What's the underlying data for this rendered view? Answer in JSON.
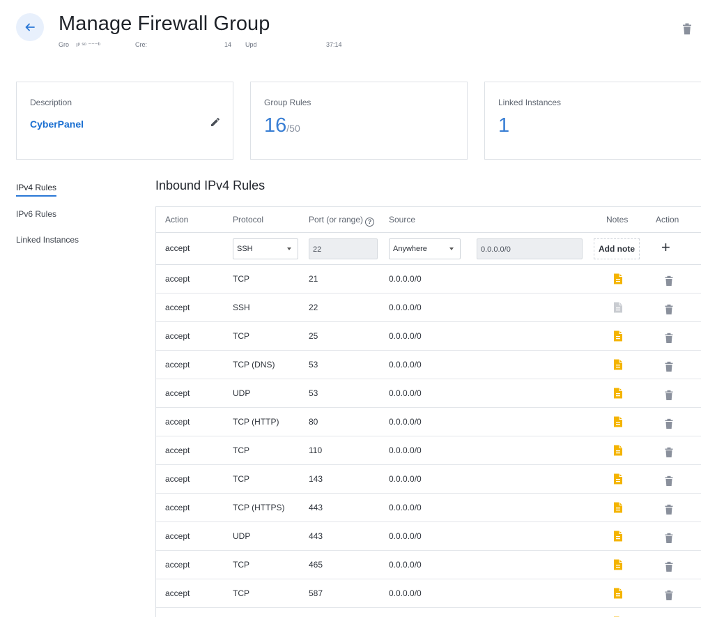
{
  "header": {
    "title": "Manage Firewall Group",
    "meta": {
      "group_label": "Gro",
      "group_value": "ıᵖ  ˢᵒ    ⁻⁻⁻ᵇ",
      "created_label": "Cre:",
      "created_value": "14",
      "updated_label": "Upd",
      "updated_value": "37:14"
    }
  },
  "cards": {
    "description": {
      "label": "Description",
      "value": "CyberPanel"
    },
    "group_rules": {
      "label": "Group Rules",
      "count": "16",
      "max": "/50"
    },
    "linked_instances": {
      "label": "Linked Instances",
      "count": "1"
    }
  },
  "side_nav": {
    "items": [
      {
        "label": "IPv4 Rules",
        "active": true
      },
      {
        "label": "IPv6 Rules",
        "active": false
      },
      {
        "label": "Linked Instances",
        "active": false
      }
    ]
  },
  "section": {
    "title": "Inbound IPv4 Rules"
  },
  "table": {
    "headers": {
      "action": "Action",
      "protocol": "Protocol",
      "port": "Port (or range)",
      "source": "Source",
      "notes": "Notes",
      "action2": "Action"
    },
    "help_glyph": "?",
    "add_row": {
      "action": "accept",
      "protocol": "SSH",
      "port": "22",
      "source": "Anywhere",
      "cidr": "0.0.0.0/0",
      "add_note_label": "Add note",
      "add_symbol": "+"
    },
    "rows": [
      {
        "action": "accept",
        "protocol": "TCP",
        "port": "21",
        "source": "0.0.0.0/0",
        "has_note": true
      },
      {
        "action": "accept",
        "protocol": "SSH",
        "port": "22",
        "source": "0.0.0.0/0",
        "has_note": false
      },
      {
        "action": "accept",
        "protocol": "TCP",
        "port": "25",
        "source": "0.0.0.0/0",
        "has_note": true
      },
      {
        "action": "accept",
        "protocol": "TCP (DNS)",
        "port": "53",
        "source": "0.0.0.0/0",
        "has_note": true
      },
      {
        "action": "accept",
        "protocol": "UDP",
        "port": "53",
        "source": "0.0.0.0/0",
        "has_note": true
      },
      {
        "action": "accept",
        "protocol": "TCP (HTTP)",
        "port": "80",
        "source": "0.0.0.0/0",
        "has_note": true
      },
      {
        "action": "accept",
        "protocol": "TCP",
        "port": "110",
        "source": "0.0.0.0/0",
        "has_note": true
      },
      {
        "action": "accept",
        "protocol": "TCP",
        "port": "143",
        "source": "0.0.0.0/0",
        "has_note": true
      },
      {
        "action": "accept",
        "protocol": "TCP (HTTPS)",
        "port": "443",
        "source": "0.0.0.0/0",
        "has_note": true
      },
      {
        "action": "accept",
        "protocol": "UDP",
        "port": "443",
        "source": "0.0.0.0/0",
        "has_note": true
      },
      {
        "action": "accept",
        "protocol": "TCP",
        "port": "465",
        "source": "0.0.0.0/0",
        "has_note": true
      },
      {
        "action": "accept",
        "protocol": "TCP",
        "port": "587",
        "source": "0.0.0.0/0",
        "has_note": true
      },
      {
        "action": "",
        "protocol": "",
        "port": "",
        "source": "",
        "has_note": true
      }
    ]
  },
  "icons": {
    "back": "arrow-left-icon",
    "delete": "trash-icon",
    "edit": "pencil-icon",
    "note": "document-icon",
    "help": "question-circle-icon"
  },
  "colors": {
    "accent": "#2a78d6",
    "link": "#1a6fd1",
    "note_active": "#f4b400",
    "note_inactive": "#c9ccd1",
    "trash": "#8a909c"
  }
}
